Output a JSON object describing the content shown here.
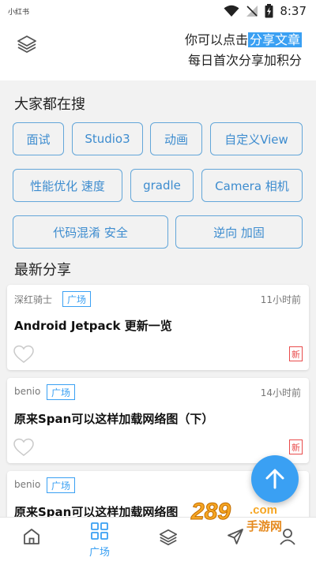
{
  "status_bar": {
    "carrier": "小红书",
    "time": "8:37"
  },
  "header": {
    "line1_prefix": "你可以点击",
    "line1_highlight": "分享文章",
    "line2": "每日首次分享加积分"
  },
  "hot_search": {
    "title": "大家都在搜",
    "tags": [
      "面试",
      "Studio3",
      "动画",
      "自定义View",
      "性能优化 速度",
      "gradle",
      "Camera 相机",
      "代码混淆 安全",
      "逆向 加固"
    ]
  },
  "latest": {
    "title": "最新分享",
    "cards": [
      {
        "author": "深红骑士",
        "badge": "广场",
        "time": "11小时前",
        "title": "Android Jetpack 更新一览",
        "new_label": "新"
      },
      {
        "author": "benio",
        "badge": "广场",
        "time": "14小时前",
        "title": "原来Span可以这样加载网络图（下）",
        "new_label": "新"
      },
      {
        "author": "benio",
        "badge": "广场",
        "time": "",
        "title": "原来Span可以这样加载网络图",
        "new_label": ""
      }
    ]
  },
  "bottom_nav": {
    "square_label": "广场"
  },
  "watermark": {
    "text_num": "289",
    "text_domain": ".com",
    "text_cn": "手游网"
  },
  "colors": {
    "accent": "#3aa0f3",
    "tag_border": "#63a6d9",
    "new_red": "#e94b4b"
  }
}
